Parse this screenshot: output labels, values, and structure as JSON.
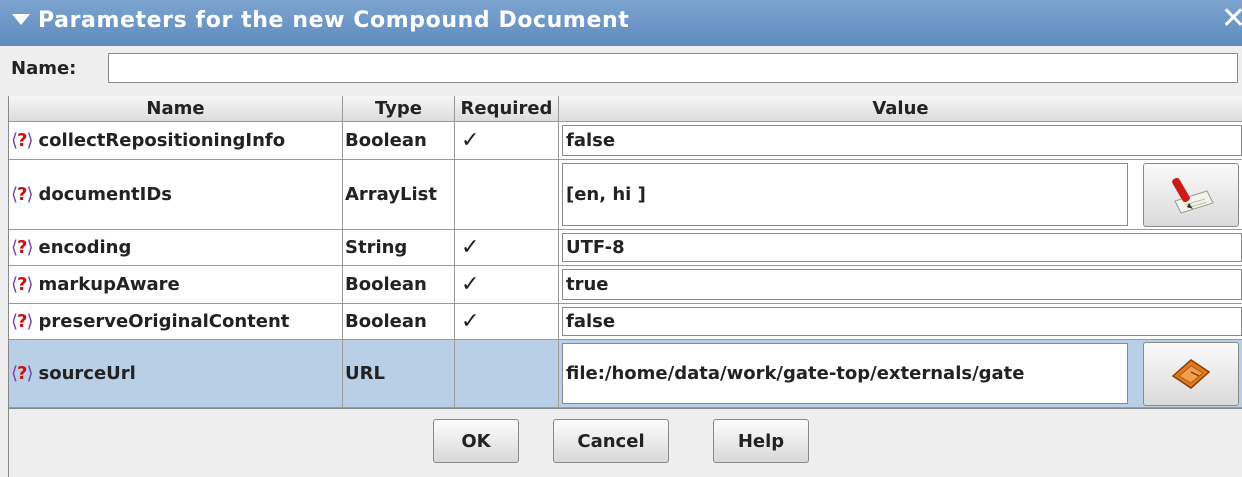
{
  "dialog": {
    "title": "Parameters for the new Compound Document",
    "close_glyph": "✕"
  },
  "name_row": {
    "label": "Name:",
    "value": ""
  },
  "table": {
    "headers": [
      "Name",
      "Type",
      "Required",
      "Value"
    ],
    "rows": [
      {
        "name": "collectRepositioningInfo",
        "type": "Boolean",
        "required": "✓",
        "value": "false"
      },
      {
        "name": "documentIDs",
        "type": "ArrayList",
        "required": "",
        "value": "[en, hi ]",
        "button_icon": "edit-list-icon"
      },
      {
        "name": "encoding",
        "type": "String",
        "required": "✓",
        "value": "UTF-8"
      },
      {
        "name": "markupAware",
        "type": "Boolean",
        "required": "✓",
        "value": "true"
      },
      {
        "name": "preserveOriginalContent",
        "type": "Boolean",
        "required": "✓",
        "value": "false"
      },
      {
        "name": "sourceUrl",
        "type": "URL",
        "required": "",
        "value": "file:/home/data/work/gate-top/externals/gate",
        "button_icon": "open-file-icon",
        "selected": true
      }
    ]
  },
  "param_icon": {
    "open": "⟨",
    "mark": "?",
    "close": "⟩"
  },
  "buttons": {
    "ok": "OK",
    "cancel": "Cancel",
    "help": "Help"
  },
  "colors": {
    "title_bar": "#6f97c7",
    "selected_row": "#b8cfe5",
    "help_icon": "#cc1010"
  }
}
